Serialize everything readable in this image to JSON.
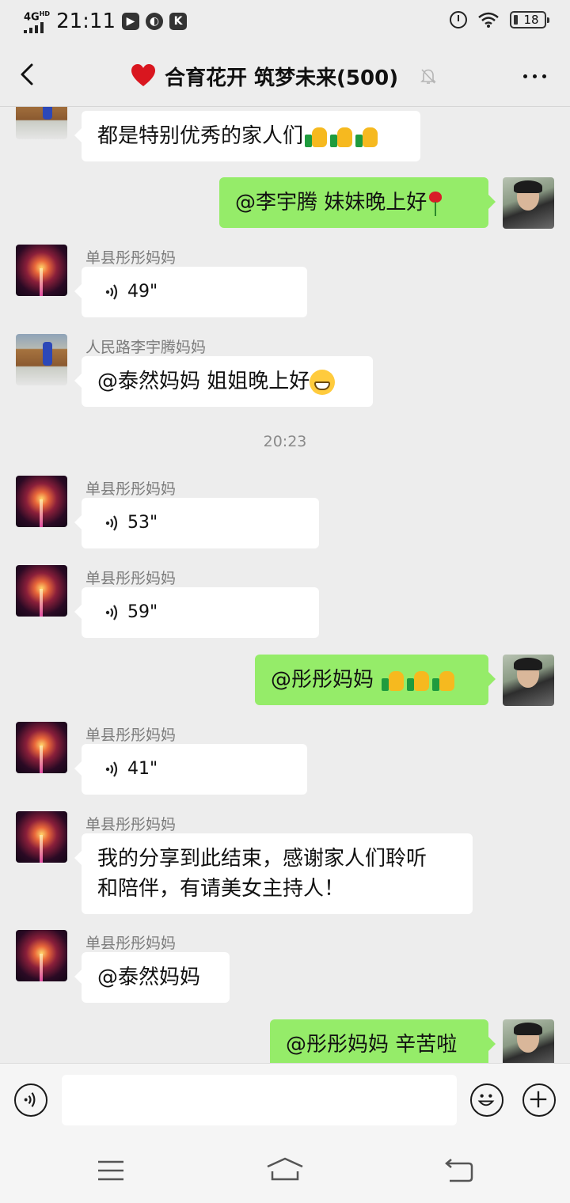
{
  "status_bar": {
    "network": "4G",
    "network_sup": "HD",
    "time": "21:11",
    "battery": "18",
    "icons": [
      "signal-icon",
      "player-icon",
      "swirl-app-icon",
      "k-app-icon",
      "alarm-icon",
      "wifi-icon",
      "battery-icon"
    ]
  },
  "header": {
    "title": "合育花开 筑梦未来(500)",
    "back_icon": "chevron-left-icon",
    "title_icon": "heart-icon",
    "mute_icon": "bell-muted-icon",
    "more_icon": "more-dots-icon"
  },
  "messages": [
    {
      "type": "text",
      "side": "in",
      "avatar": "runner",
      "text": "都是特别优秀的家人们",
      "emoji": [
        "thumbs-up",
        "thumbs-up",
        "thumbs-up"
      ]
    },
    {
      "type": "text",
      "side": "out",
      "avatar": "self",
      "text": "@李宇腾  妹妹晚上好",
      "emoji": [
        "rose"
      ]
    },
    {
      "type": "voice",
      "side": "in",
      "avatar": "fireworks",
      "sender": "单县彤彤妈妈",
      "duration": "49\""
    },
    {
      "type": "text",
      "side": "in",
      "avatar": "runner",
      "sender": "人民路李宇腾妈妈",
      "text": "@泰然妈妈  姐姐晚上好",
      "emoji": [
        "grin"
      ]
    },
    {
      "type": "time",
      "text": "20:23"
    },
    {
      "type": "voice",
      "side": "in",
      "avatar": "fireworks",
      "sender": "单县彤彤妈妈",
      "duration": "53\""
    },
    {
      "type": "voice",
      "side": "in",
      "avatar": "fireworks",
      "sender": "单县彤彤妈妈",
      "duration": "59\""
    },
    {
      "type": "text",
      "side": "out",
      "avatar": "self",
      "text": "@彤彤妈妈 ",
      "emoji": [
        "thumbs-up",
        "thumbs-up",
        "thumbs-up"
      ]
    },
    {
      "type": "voice",
      "side": "in",
      "avatar": "fireworks",
      "sender": "单县彤彤妈妈",
      "duration": "41\""
    },
    {
      "type": "text",
      "side": "in",
      "avatar": "fireworks",
      "sender": "单县彤彤妈妈",
      "text_line1": "我的分享到此结束，感谢家人们聆听",
      "text_line2": "和陪伴，有请美女主持人！"
    },
    {
      "type": "text",
      "side": "in",
      "avatar": "fireworks",
      "sender": "单县彤彤妈妈",
      "text": "@泰然妈妈"
    },
    {
      "type": "text",
      "side": "out",
      "avatar": "self",
      "text": "@彤彤妈妈  辛苦啦"
    }
  ],
  "input_bar": {
    "voice_icon": "voice-input-icon",
    "input_value": "",
    "emoji_icon": "smiley-icon",
    "add_icon": "plus-icon"
  },
  "nav_bar": {
    "icons": [
      "menu-lines-icon",
      "home-icon",
      "back-arrow-icon"
    ]
  },
  "colors": {
    "background": "#ededed",
    "outgoing_bubble": "#95ec69",
    "incoming_bubble": "#ffffff"
  }
}
